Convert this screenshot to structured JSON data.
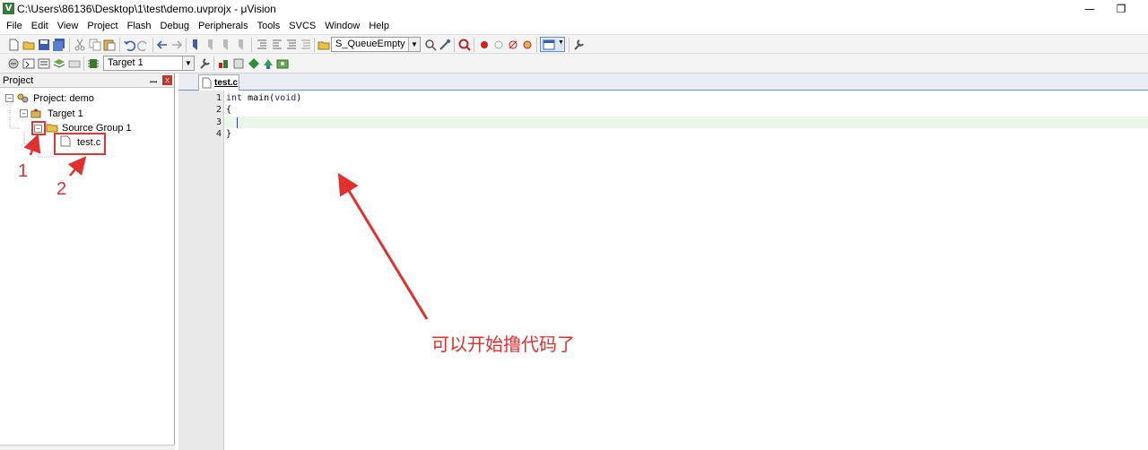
{
  "window": {
    "title": "C:\\Users\\86136\\Desktop\\1\\test\\demo.uvprojx - μVision",
    "app_icon_letter": "V",
    "controls": {
      "minimize": "—",
      "restore": "❐"
    }
  },
  "menu": [
    "File",
    "Edit",
    "View",
    "Project",
    "Flash",
    "Debug",
    "Peripherals",
    "Tools",
    "SVCS",
    "Window",
    "Help"
  ],
  "toolbar": {
    "find_combo_value": "S_QueueEmpty",
    "target_combo_value": "Target 1"
  },
  "project_panel": {
    "title": "Project",
    "pin": "ꟷ",
    "close": "x",
    "tree": {
      "project": "Project: demo",
      "target": "Target 1",
      "group": "Source Group 1",
      "file": "test.c"
    }
  },
  "editor": {
    "tab": "test.c",
    "line_numbers": [
      "1",
      "2",
      "3",
      "4"
    ],
    "lines": {
      "l1_kw1": "int",
      "l1_mid": " main(",
      "l1_kw2": "void",
      "l1_end": ")",
      "l2": "{",
      "l3": "",
      "l4": "}"
    }
  },
  "annotations": {
    "label_1": "1",
    "label_2": "2",
    "main_text": "可以开始撸代码了"
  },
  "colors": {
    "annotation_red": "#e03030",
    "current_line": "#eaf7ea"
  }
}
